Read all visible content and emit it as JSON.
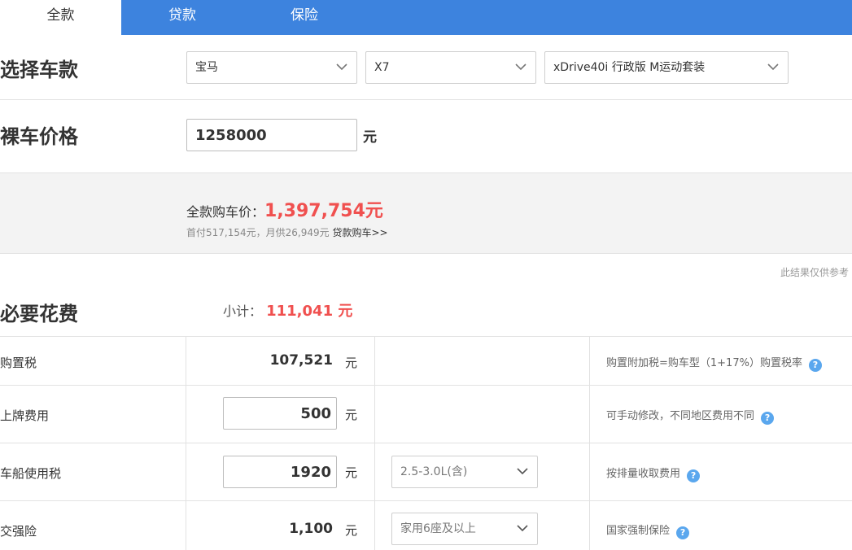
{
  "tabs": [
    {
      "label": "全款",
      "active": true
    },
    {
      "label": "贷款",
      "active": false
    },
    {
      "label": "保险",
      "active": false
    }
  ],
  "car_select": {
    "title": "选择车款",
    "brand": "宝马",
    "series": "X7",
    "model": "xDrive40i 行政版 M运动套装"
  },
  "price": {
    "title": "裸车价格",
    "value": "1258000",
    "unit": "元"
  },
  "summary": {
    "label": "全款购车价：",
    "value": "1,397,754元",
    "sub_text": "首付517,154元，月供26,949元",
    "link": "贷款购车>>"
  },
  "note": "此结果仅供参考",
  "required": {
    "title": "必要花费",
    "subtotal_label": "小计：",
    "subtotal_value": "111,041 元"
  },
  "rows": [
    {
      "label": "购置税",
      "value": "107,521",
      "unit": "元",
      "note": "购置附加税=购车型（1+17%）购置税率"
    },
    {
      "label": "上牌费用",
      "value": "500",
      "unit": "元",
      "note": "可手动修改，不同地区费用不同"
    },
    {
      "label": "车船使用税",
      "value": "1920",
      "unit": "元",
      "select": "2.5-3.0L(含)",
      "note": "按排量收取费用"
    },
    {
      "label": "交强险",
      "value": "1,100",
      "unit": "元",
      "select": "家用6座及以上",
      "note": "国家强制保险"
    }
  ],
  "colors": {
    "tab_bar": "#3d83de",
    "highlight": "#f0504f",
    "help_icon": "#5aa7ee"
  }
}
